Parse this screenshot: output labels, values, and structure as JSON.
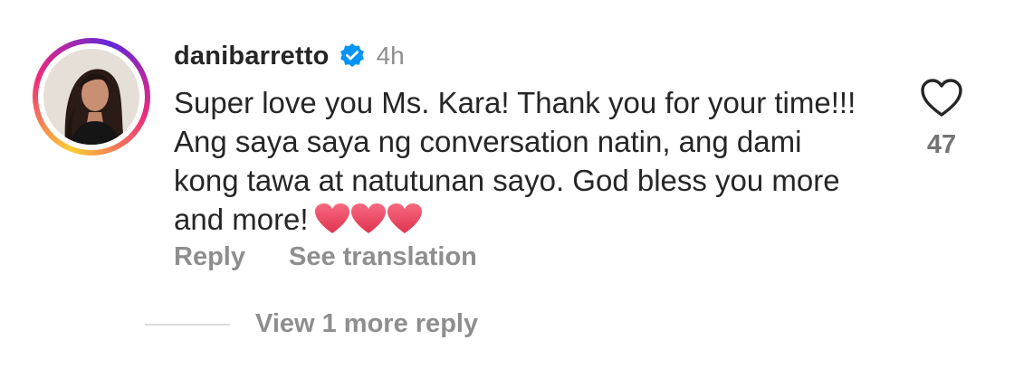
{
  "comment": {
    "username": "danibarretto",
    "verified": true,
    "timestamp": "4h",
    "text": "Super love you Ms. Kara! Thank you for your time!!! Ang saya saya ng conversation natin, ang dami kong tawa at natutunan sayo. God bless you more and more!",
    "emoji": [
      "red-heart-emoji",
      "red-heart-emoji",
      "red-heart-emoji"
    ],
    "actions": {
      "reply_label": "Reply",
      "see_translation_label": "See translation"
    },
    "replies": {
      "view_more_label": "View 1 more reply"
    },
    "likes": {
      "count": "47",
      "icon": "heart-outline-icon"
    }
  },
  "colors": {
    "primary_text": "#262626",
    "secondary_text": "#8e8e8e",
    "verified_badge": "#0095f6",
    "heart_emoji": "#e8425a",
    "divider": "#dbdbdb"
  }
}
